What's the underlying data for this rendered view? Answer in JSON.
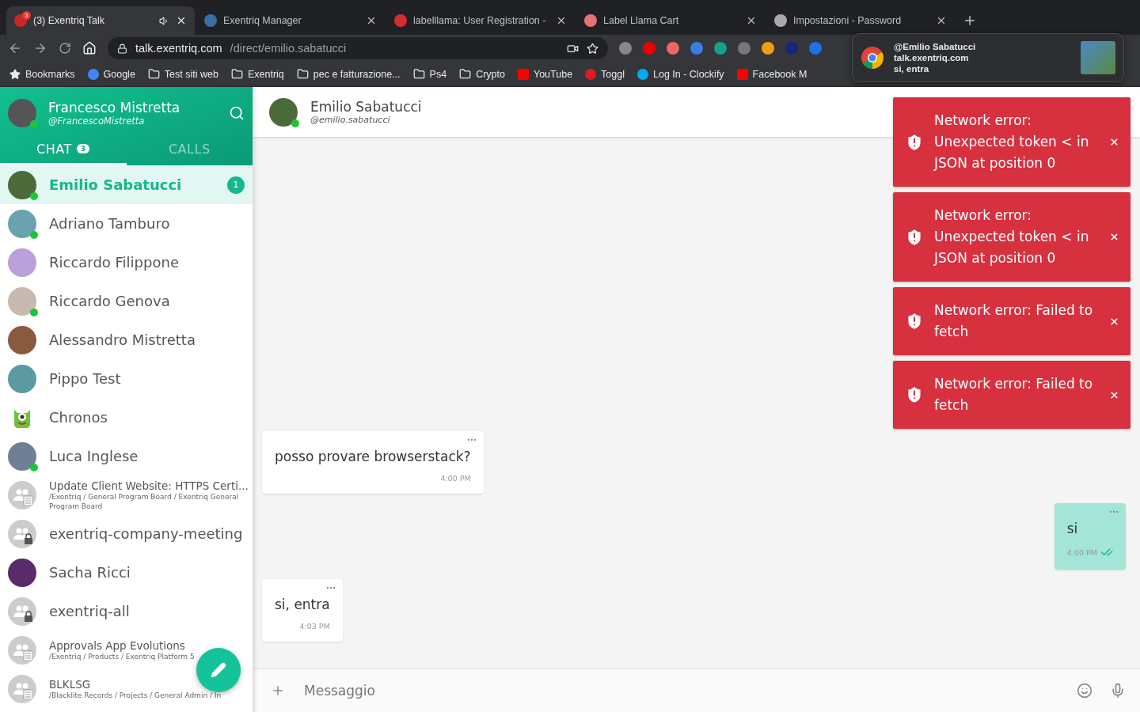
{
  "browser": {
    "tabs": [
      {
        "title": "(3) Exentriq Talk",
        "selected": true,
        "badge": "3",
        "muted": true
      },
      {
        "title": "Exentriq Manager",
        "selected": false
      },
      {
        "title": "labelllama: User Registration -",
        "selected": false
      },
      {
        "title": "Label Llama Cart",
        "selected": false
      },
      {
        "title": "Impostazioni - Password",
        "selected": false
      }
    ],
    "url_host": "talk.exentriq.com",
    "url_path": "/direct/emilio.sabatucci",
    "bookmarks": [
      {
        "label": "Bookmarks",
        "kind": "star"
      },
      {
        "label": "Google",
        "kind": "google"
      },
      {
        "label": "Test siti web",
        "kind": "folder"
      },
      {
        "label": "Exentriq",
        "kind": "folder"
      },
      {
        "label": "pec e fatturazione...",
        "kind": "folder"
      },
      {
        "label": "Ps4",
        "kind": "folder"
      },
      {
        "label": "Crypto",
        "kind": "folder"
      },
      {
        "label": "YouTube",
        "kind": "youtube"
      },
      {
        "label": "Toggl",
        "kind": "toggl"
      },
      {
        "label": "Log In - Clockify",
        "kind": "clockify"
      },
      {
        "label": "Facebook M",
        "kind": "youtube"
      }
    ],
    "notification": {
      "title": "@Emilio Sabatucci",
      "site": "talk.exentriq.com",
      "body": "si, entra"
    }
  },
  "sidebar": {
    "user": {
      "name": "Francesco Mistretta",
      "handle": "@FrancescoMistretta",
      "online": true
    },
    "tabs": [
      {
        "label": "CHAT",
        "badge": "3",
        "selected": true
      },
      {
        "label": "CALLS",
        "selected": false
      }
    ],
    "chats": [
      {
        "name": "Emilio Sabatucci",
        "kind": "person",
        "color": "#4a6a3a",
        "online": true,
        "unread": "1",
        "selected": true
      },
      {
        "name": "Adriano Tamburo",
        "kind": "person",
        "color": "#6aa3b0",
        "online": true,
        "selected": false
      },
      {
        "name": "Riccardo Filippone",
        "kind": "person",
        "color": "#b9a0d8",
        "online": false,
        "selected": false
      },
      {
        "name": "Riccardo Genova",
        "kind": "person",
        "color": "#c8b8b0",
        "online": true,
        "selected": false
      },
      {
        "name": "Alessandro Mistretta",
        "kind": "person",
        "color": "#8a5a40",
        "online": false,
        "selected": false
      },
      {
        "name": "Pippo Test",
        "kind": "person",
        "color": "#5a9aa0",
        "online": false,
        "selected": false
      },
      {
        "name": "Chronos",
        "kind": "bot",
        "selected": false
      },
      {
        "name": "Luca Inglese",
        "kind": "person",
        "color": "#6f7f95",
        "online": true,
        "selected": false
      },
      {
        "name": "Update Client Website: HTTPS Certi...",
        "kind": "board",
        "path": "/Exentriq / General Program Board / Exentriq General Program Board",
        "selected": false
      },
      {
        "name": "exentriq-company-meeting",
        "kind": "private",
        "selected": false
      },
      {
        "name": "Sacha Ricci",
        "kind": "person",
        "color": "#5a2a6a",
        "online": false,
        "selected": false
      },
      {
        "name": "exentriq-all",
        "kind": "private",
        "selected": false
      },
      {
        "name": "Approvals App Evolutions",
        "kind": "board",
        "path": "/Exentriq / Products / Exentriq Platform 5",
        "selected": false
      },
      {
        "name": "BLKLSG",
        "kind": "board",
        "path": "/Blacklite Records / Projects / General Admin / In",
        "selected": false
      }
    ]
  },
  "conversation": {
    "name": "Emilio Sabatucci",
    "handle": "@emilio.sabatucci",
    "online": true,
    "messages": [
      {
        "text": "posso provare browserstack?",
        "time": "4:00 PM",
        "outgoing": false
      },
      {
        "text": "si",
        "time": "4:00 PM",
        "outgoing": true,
        "read": true
      },
      {
        "text": "si, entra",
        "time": "4:03 PM",
        "outgoing": false
      }
    ],
    "composer_placeholder": "Messaggio"
  },
  "toasts": [
    {
      "text": "Network error: Unexpected token < in JSON at position 0"
    },
    {
      "text": "Network error: Unexpected token < in JSON at position 0"
    },
    {
      "text": "Network error: Failed to fetch"
    },
    {
      "text": "Network error: Failed to fetch"
    }
  ]
}
